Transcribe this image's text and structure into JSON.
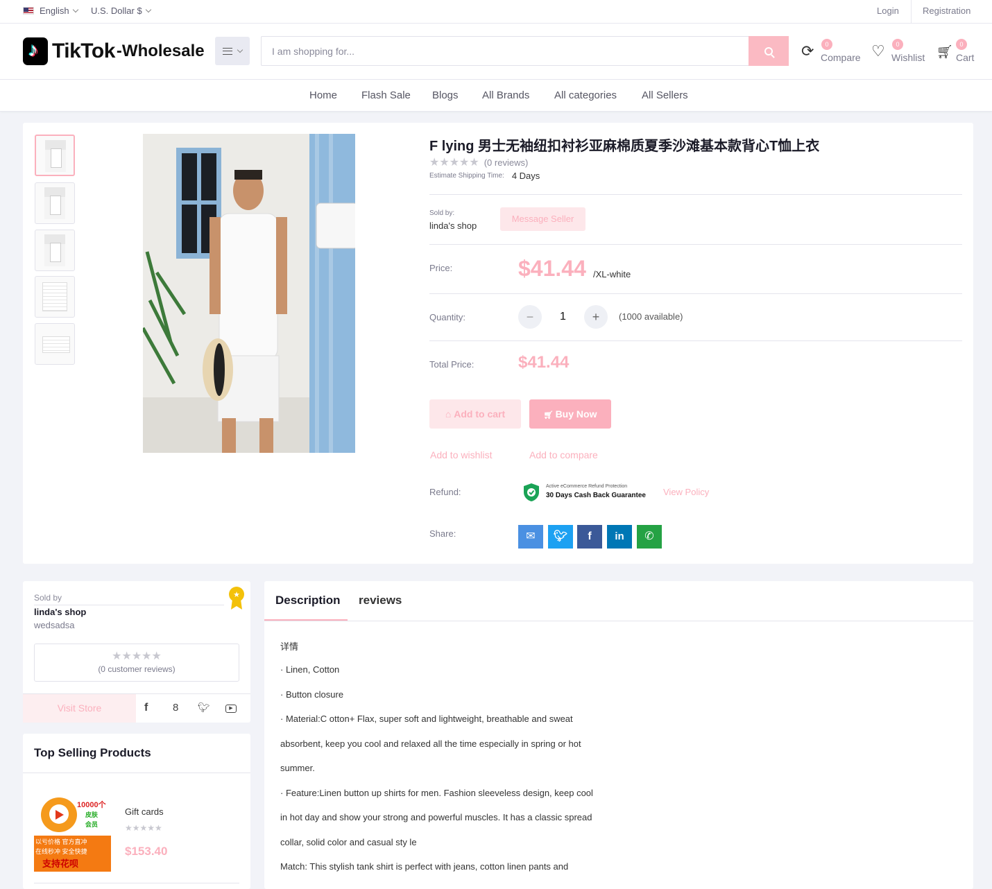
{
  "topbar": {
    "language": "English",
    "currency": "U.S. Dollar $",
    "login": "Login",
    "registration": "Registration"
  },
  "header": {
    "logo_main": "TikTok",
    "logo_sub": "-Wholesale",
    "search_placeholder": "I am shopping for...",
    "compare": {
      "label": "Compare",
      "count": "0"
    },
    "wishlist": {
      "label": "Wishlist",
      "count": "0"
    },
    "cart": {
      "label": "Cart",
      "count": "0"
    }
  },
  "nav": {
    "items": [
      "Home",
      "Flash Sale",
      "Blogs",
      "All Brands",
      "All categories",
      "All Sellers"
    ]
  },
  "product": {
    "title": "F lying 男士无袖纽扣衬衫亚麻棉质夏季沙滩基本款背心T恤上衣",
    "stars": "★★★★★",
    "reviews": "(0 reviews)",
    "shipping_label": "Estimate Shipping Time:",
    "shipping_value": "4 Days",
    "sold_by_label": "Sold by:",
    "shop_name": "linda's shop",
    "message_seller": "Message Seller",
    "price_label": "Price:",
    "price": "$41.44",
    "variant": "/XL-white",
    "quantity_label": "Quantity:",
    "quantity": "1",
    "available": "(1000 available)",
    "total_label": "Total Price:",
    "total": "$41.44",
    "add_to_cart": "Add to cart",
    "buy_now": "Buy Now",
    "add_to_wishlist": "Add to wishlist",
    "add_to_compare": "Add to compare",
    "refund_label": "Refund:",
    "refund_badge_small": "Active eCommerce Refund Protection",
    "refund_badge_big": "30 Days Cash Back Guarantee",
    "view_policy": "View Policy",
    "share_label": "Share:"
  },
  "seller": {
    "sold_by": "Sold by",
    "shop_name": "linda's shop",
    "address": "wedsadsa",
    "stars": "★★★★★",
    "customer_reviews": "(0 customer reviews)",
    "visit_store": "Visit Store"
  },
  "top_selling": {
    "title": "Top Selling Products",
    "items": [
      {
        "name": "Gift cards",
        "stars": "★★★★★",
        "price": "$153.40",
        "img_text": [
          "10000个",
          "皮肤",
          "会员",
          "以亏价格  官方直冲",
          "在线秒冲  安全快捷",
          "支持花呗"
        ]
      }
    ]
  },
  "tabs": {
    "items": [
      "Description",
      "reviews"
    ],
    "active": "Description"
  },
  "description": {
    "lines": [
      "详情",
      "· Linen, Cotton",
      "· Button closure",
      "· Material:C otton+ Flax, super soft and lightweight, breathable and sweat",
      "absorbent, keep you cool and relaxed all the time especially in spring or hot",
      "summer.",
      "·  Feature:Linen button up shirts for men. Fashion sleeveless design, keep cool",
      "in hot day and show your strong and powerful muscles. It has a classic spread",
      "collar, solid color and casual sty le",
      "Match: This stylish tank shirt is perfect with jeans, cotton linen pants and"
    ]
  },
  "colors": {
    "accent": "#fbb0bd",
    "email": "#4a90e2",
    "twitter": "#1da1f2",
    "facebook": "#3b5998",
    "linkedin": "#0077b5",
    "whatsapp": "#25a244"
  }
}
